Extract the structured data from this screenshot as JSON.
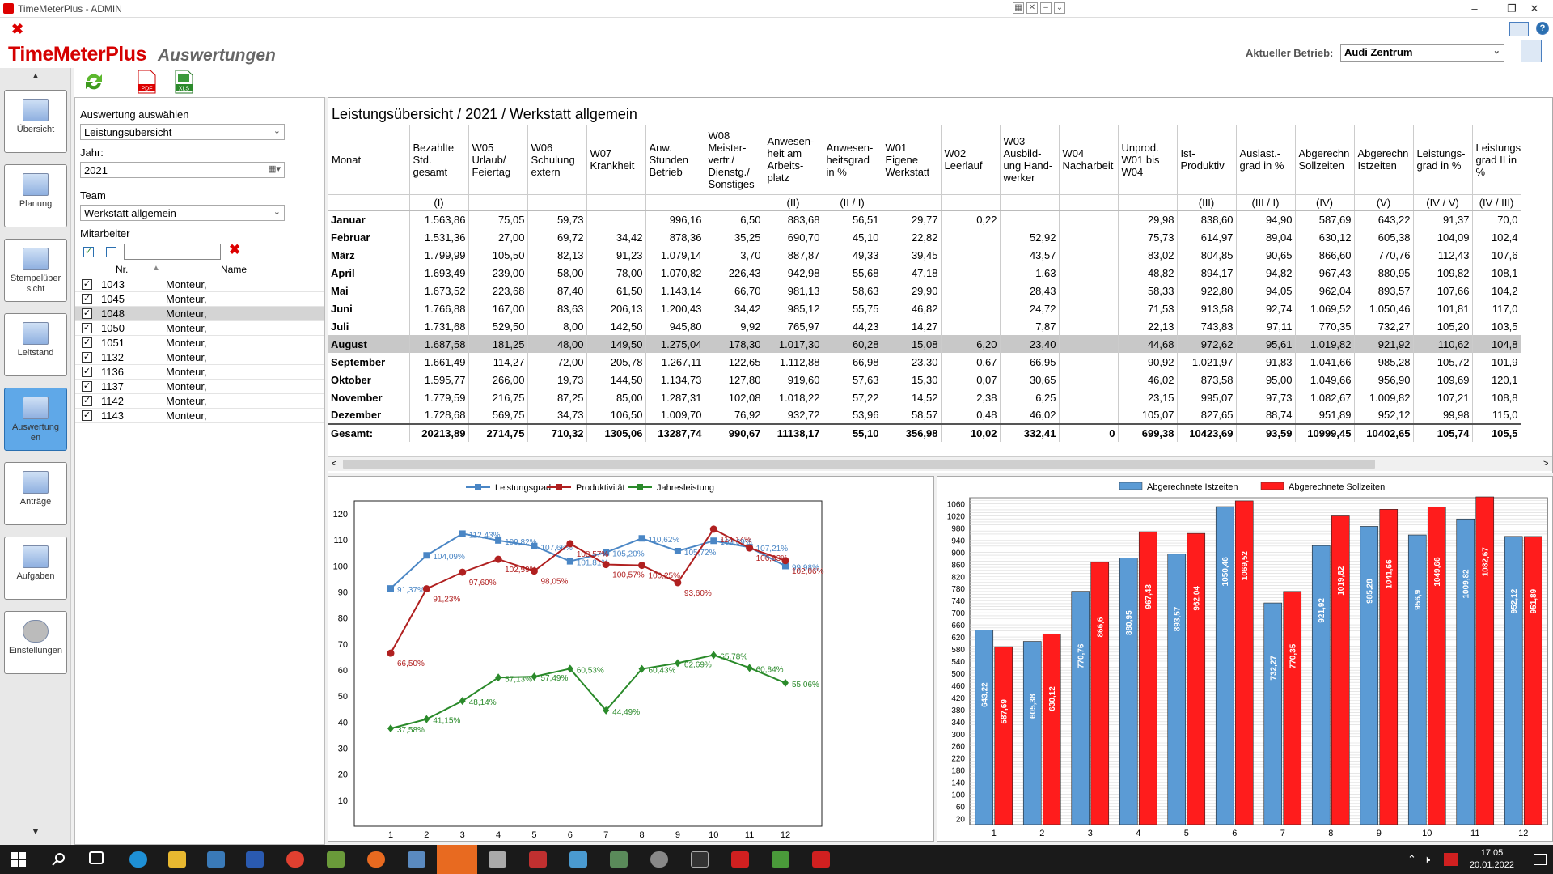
{
  "window": {
    "title": "TimeMeterPlus - ADMIN"
  },
  "header": {
    "brand": "TimeMeterPlus",
    "section": "Auswertungen",
    "betrieb_label": "Aktueller Betrieb:",
    "betrieb_value": "Audi Zentrum"
  },
  "nav": {
    "items": [
      {
        "label": "Übersicht"
      },
      {
        "label": "Planung"
      },
      {
        "label": "Stempelüber sicht"
      },
      {
        "label": "Leitstand"
      },
      {
        "label": "Auswertung en"
      },
      {
        "label": "Anträge"
      },
      {
        "label": "Aufgaben"
      },
      {
        "label": "Einstellungen"
      }
    ]
  },
  "filters": {
    "auswertung_label": "Auswertung auswählen",
    "auswertung_value": "Leistungsübersicht",
    "jahr_label": "Jahr:",
    "jahr_value": "2021",
    "team_label": "Team",
    "team_value": "Werkstatt allgemein",
    "mitarbeiter_label": "Mitarbeiter",
    "col_nr": "Nr.",
    "col_name": "Name"
  },
  "employees": [
    {
      "nr": "1043",
      "name": "Monteur,"
    },
    {
      "nr": "1045",
      "name": "Monteur,"
    },
    {
      "nr": "1048",
      "name": "Monteur,"
    },
    {
      "nr": "1050",
      "name": "Monteur,"
    },
    {
      "nr": "1051",
      "name": "Monteur,"
    },
    {
      "nr": "1132",
      "name": "Monteur,"
    },
    {
      "nr": "1136",
      "name": "Monteur,"
    },
    {
      "nr": "1137",
      "name": "Monteur,"
    },
    {
      "nr": "1142",
      "name": "Monteur,"
    },
    {
      "nr": "1143",
      "name": "Monteur,"
    }
  ],
  "table": {
    "title": "Leistungsübersicht / 2021 / Werkstatt allgemein",
    "headers": [
      "Monat",
      "Bezahlte Std. gesamt",
      "W05 Urlaub/ Feiertag",
      "W06 Schulung extern",
      "W07 Krankheit",
      "Anw. Stunden Betrieb",
      "W08 Meister-vertr./ Dienstg./ Sonstiges",
      "Anwesen-heit am Arbeits-platz",
      "Anwesen-heitsgrad in %",
      "W01 Eigene Werkstatt",
      "W02 Leerlauf",
      "W03 Ausbild-ung Hand-werker",
      "W04 Nacharbeit",
      "Unprod. W01 bis W04",
      "Ist-Produktiv",
      "Auslast.-grad in %",
      "Abgerechn Sollzeiten",
      "Abgerechn Istzeiten",
      "Leistungs-grad in %",
      "Leistungs-grad II in %"
    ],
    "subheaders": [
      "",
      "(I)",
      "",
      "",
      "",
      "",
      "",
      "(II)",
      "(II / I)",
      "",
      "",
      "",
      "",
      "",
      "(III)",
      "(III / I)",
      "(IV)",
      "(V)",
      "(IV / V)",
      "(IV / III)"
    ],
    "rows": [
      [
        "Januar",
        "1.563,86",
        "75,05",
        "59,73",
        "",
        "996,16",
        "6,50",
        "883,68",
        "56,51",
        "29,77",
        "0,22",
        "",
        "",
        "29,98",
        "838,60",
        "94,90",
        "587,69",
        "643,22",
        "91,37",
        "70,0"
      ],
      [
        "Februar",
        "1.531,36",
        "27,00",
        "69,72",
        "34,42",
        "878,36",
        "35,25",
        "690,70",
        "45,10",
        "22,82",
        "",
        "52,92",
        "",
        "75,73",
        "614,97",
        "89,04",
        "630,12",
        "605,38",
        "104,09",
        "102,4"
      ],
      [
        "März",
        "1.799,99",
        "105,50",
        "82,13",
        "91,23",
        "1.079,14",
        "3,70",
        "887,87",
        "49,33",
        "39,45",
        "",
        "43,57",
        "",
        "83,02",
        "804,85",
        "90,65",
        "866,60",
        "770,76",
        "112,43",
        "107,6"
      ],
      [
        "April",
        "1.693,49",
        "239,00",
        "58,00",
        "78,00",
        "1.070,82",
        "226,43",
        "942,98",
        "55,68",
        "47,18",
        "",
        "1,63",
        "",
        "48,82",
        "894,17",
        "94,82",
        "967,43",
        "880,95",
        "109,82",
        "108,1"
      ],
      [
        "Mai",
        "1.673,52",
        "223,68",
        "87,40",
        "61,50",
        "1.143,14",
        "66,70",
        "981,13",
        "58,63",
        "29,90",
        "",
        "28,43",
        "",
        "58,33",
        "922,80",
        "94,05",
        "962,04",
        "893,57",
        "107,66",
        "104,2"
      ],
      [
        "Juni",
        "1.766,88",
        "167,00",
        "83,63",
        "206,13",
        "1.200,43",
        "34,42",
        "985,12",
        "55,75",
        "46,82",
        "",
        "24,72",
        "",
        "71,53",
        "913,58",
        "92,74",
        "1.069,52",
        "1.050,46",
        "101,81",
        "117,0"
      ],
      [
        "Juli",
        "1.731,68",
        "529,50",
        "8,00",
        "142,50",
        "945,80",
        "9,92",
        "765,97",
        "44,23",
        "14,27",
        "",
        "7,87",
        "",
        "22,13",
        "743,83",
        "97,11",
        "770,35",
        "732,27",
        "105,20",
        "103,5"
      ],
      [
        "August",
        "1.687,58",
        "181,25",
        "48,00",
        "149,50",
        "1.275,04",
        "178,30",
        "1.017,30",
        "60,28",
        "15,08",
        "6,20",
        "23,40",
        "",
        "44,68",
        "972,62",
        "95,61",
        "1.019,82",
        "921,92",
        "110,62",
        "104,8"
      ],
      [
        "September",
        "1.661,49",
        "114,27",
        "72,00",
        "205,78",
        "1.267,11",
        "122,65",
        "1.112,88",
        "66,98",
        "23,30",
        "0,67",
        "66,95",
        "",
        "90,92",
        "1.021,97",
        "91,83",
        "1.041,66",
        "985,28",
        "105,72",
        "101,9"
      ],
      [
        "Oktober",
        "1.595,77",
        "266,00",
        "19,73",
        "144,50",
        "1.134,73",
        "127,80",
        "919,60",
        "57,63",
        "15,30",
        "0,07",
        "30,65",
        "",
        "46,02",
        "873,58",
        "95,00",
        "1.049,66",
        "956,90",
        "109,69",
        "120,1"
      ],
      [
        "November",
        "1.779,59",
        "216,75",
        "87,25",
        "85,00",
        "1.287,31",
        "102,08",
        "1.018,22",
        "57,22",
        "14,52",
        "2,38",
        "6,25",
        "",
        "23,15",
        "995,07",
        "97,73",
        "1.082,67",
        "1.009,82",
        "107,21",
        "108,8"
      ],
      [
        "Dezember",
        "1.728,68",
        "569,75",
        "34,73",
        "106,50",
        "1.009,70",
        "76,92",
        "932,72",
        "53,96",
        "58,57",
        "0,48",
        "46,02",
        "",
        "105,07",
        "827,65",
        "88,74",
        "951,89",
        "952,12",
        "99,98",
        "115,0"
      ],
      [
        "Gesamt:",
        "20213,89",
        "2714,75",
        "710,32",
        "1305,06",
        "13287,74",
        "990,67",
        "11138,17",
        "55,10",
        "356,98",
        "10,02",
        "332,41",
        "0",
        "699,38",
        "10423,69",
        "93,59",
        "10999,45",
        "10402,65",
        "105,74",
        "105,5"
      ]
    ]
  },
  "chart_data": [
    {
      "type": "line",
      "categories": [
        "1",
        "2",
        "3",
        "4",
        "5",
        "6",
        "7",
        "8",
        "9",
        "10",
        "11",
        "12"
      ],
      "yticks": [
        "120",
        "110",
        "100",
        "90",
        "80",
        "70",
        "60",
        "50",
        "40",
        "30",
        "20",
        "10"
      ],
      "ylim": [
        0,
        125
      ],
      "series": [
        {
          "name": "Leistungsgrad",
          "color": "#4a86c5",
          "values": [
            91.37,
            104.09,
            112.43,
            109.82,
            107.66,
            101.81,
            105.2,
            110.62,
            105.72,
            109.69,
            107.21,
            99.98
          ],
          "labels": [
            "91,37%",
            "104,09%",
            "112,43%",
            "109,82%",
            "107,66%",
            "101,81%",
            "105,20%",
            "110,62%",
            "105,72%",
            "109,69%",
            "107,21%",
            "99,98%"
          ]
        },
        {
          "name": "Produktivität",
          "color": "#b02020",
          "values": [
            66.5,
            91.23,
            97.6,
            102.59,
            98.05,
            108.57,
            100.57,
            100.25,
            93.6,
            114.14,
            106.93,
            102.06
          ],
          "labels": [
            "66,50%",
            "91,23%",
            "97,60%",
            "102,59%",
            "98,05%",
            "108,57%",
            "100,57%",
            "100,25%",
            "93,60%",
            "114,14%",
            "106,93%",
            "102,06%"
          ]
        },
        {
          "name": "Jahresleistung",
          "color": "#2a8a2a",
          "values": [
            37.58,
            41.15,
            48.14,
            57.13,
            57.49,
            60.53,
            44.49,
            60.43,
            62.69,
            65.78,
            60.84,
            55.06
          ],
          "labels": [
            "37,58%",
            "41,15%",
            "48,14%",
            "57,13%",
            "57,49%",
            "60,53%",
            "44,49%",
            "60,43%",
            "62,69%",
            "65,78%",
            "60,84%",
            "55,06%"
          ]
        }
      ]
    },
    {
      "type": "bar",
      "categories": [
        "1",
        "2",
        "3",
        "4",
        "5",
        "6",
        "7",
        "8",
        "9",
        "10",
        "11",
        "12"
      ],
      "yticks": [
        "1060",
        "1020",
        "980",
        "940",
        "900",
        "860",
        "820",
        "780",
        "740",
        "700",
        "660",
        "620",
        "580",
        "540",
        "500",
        "460",
        "420",
        "380",
        "340",
        "300",
        "260",
        "220",
        "180",
        "140",
        "100",
        "60",
        "20"
      ],
      "ylim": [
        0,
        1080
      ],
      "series": [
        {
          "name": "Abgerechnete Istzeiten",
          "color": "#5b9bd5",
          "values": [
            643.22,
            605.38,
            770.76,
            880.95,
            893.57,
            1050.46,
            732.27,
            921.92,
            985.28,
            956.9,
            1009.82,
            952.12
          ],
          "labels": [
            "643,22",
            "605,38",
            "770,76",
            "880,95",
            "893,57",
            "1050,46",
            "732,27",
            "921,92",
            "985,28",
            "956,9",
            "1009,82",
            "952,12"
          ]
        },
        {
          "name": "Abgerechnete Sollzeiten",
          "color": "#ff1c1c",
          "values": [
            587.69,
            630.12,
            866.6,
            967.43,
            962.04,
            1069.52,
            770.35,
            1019.82,
            1041.66,
            1049.66,
            1082.67,
            951.89
          ],
          "labels": [
            "587,69",
            "630,12",
            "866,6",
            "967,43",
            "962,04",
            "1069,52",
            "770,35",
            "1019,82",
            "1041,66",
            "1049,66",
            "1082,67",
            "951,89"
          ]
        }
      ]
    }
  ],
  "taskbar": {
    "time": "17:05",
    "date": "20.01.2022"
  }
}
